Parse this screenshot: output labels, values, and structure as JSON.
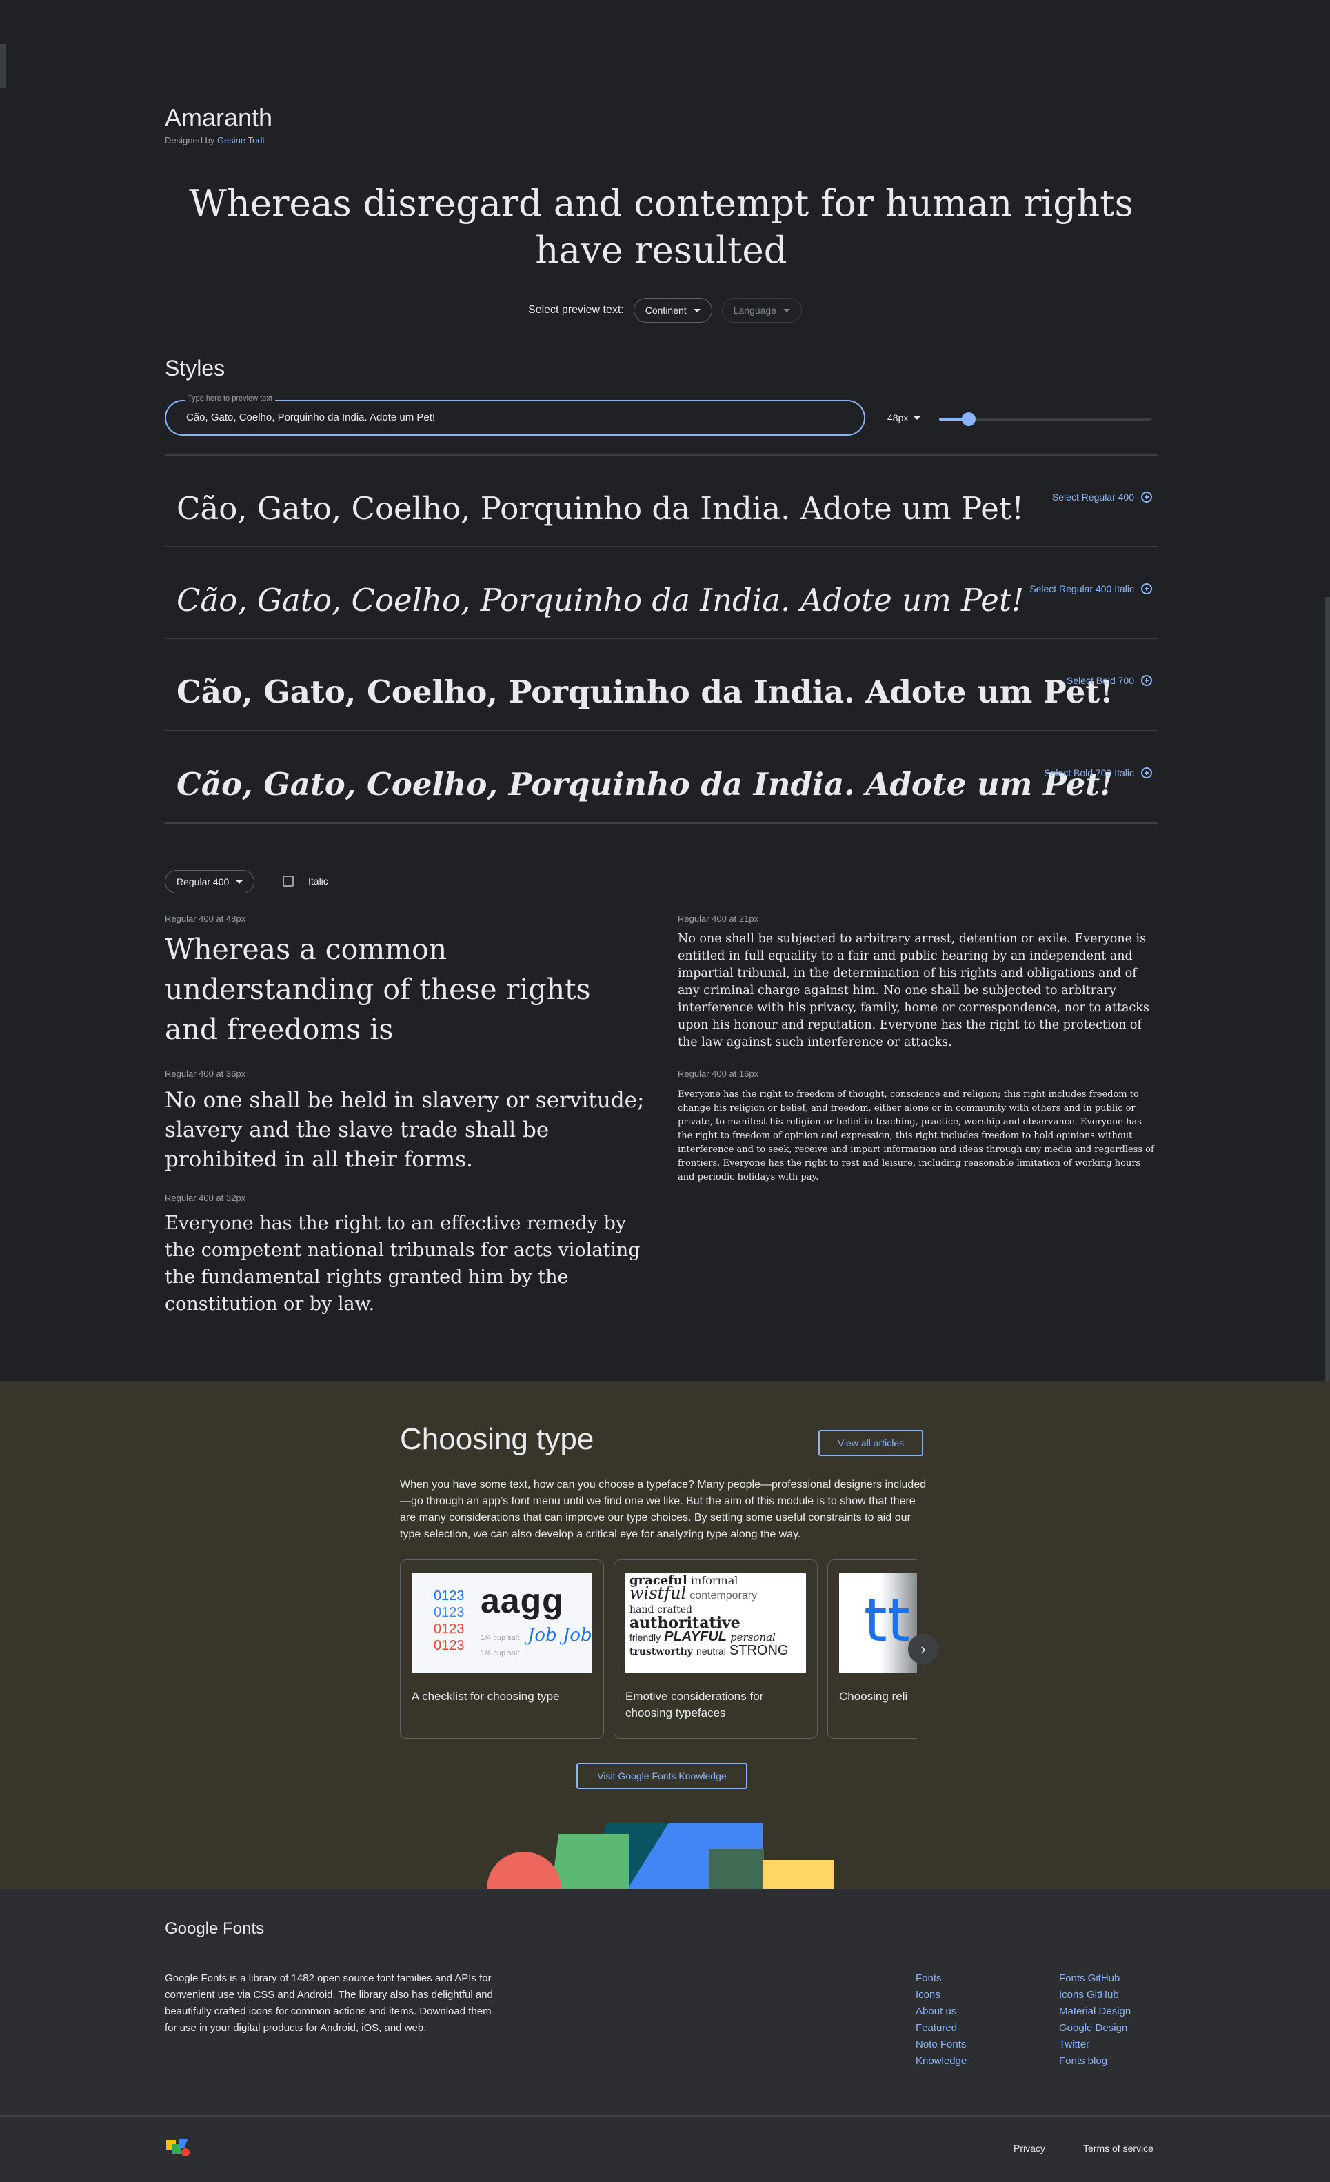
{
  "family": {
    "name": "Amaranth",
    "designed_by": "Designed by",
    "designer": "Gesine Todt"
  },
  "hero_text": "Whereas disregard and contempt for human rights have resulted",
  "preview_controls": {
    "label": "Select preview text:",
    "continent": "Continent",
    "language": "Language"
  },
  "styles": {
    "title": "Styles",
    "input_label": "Type here to preview text",
    "input_value": "Cão, Gato, Coelho, Porquinho da India. Adote um Pet!",
    "size": "48px",
    "size_level_fraction": 0.14,
    "rows": [
      {
        "sample": "Cão, Gato, Coelho, Porquinho da India. Adote um Pet!",
        "select": "Select Regular 400"
      },
      {
        "sample": "Cão, Gato, Coelho, Porquinho da India. Adote um Pet!",
        "select": "Select Regular 400 Italic"
      },
      {
        "sample": "Cão, Gato, Coelho, Porquinho da India. Adote um Pet!",
        "select": "Select Bold 700"
      },
      {
        "sample": "Cão, Gato, Coelho, Porquinho da India. Adote um Pet!",
        "select": "Select Bold 700 Italic"
      }
    ]
  },
  "specimen": {
    "weight": "Regular 400",
    "italic_label": "Italic",
    "blocks": [
      {
        "label": "Regular 400 at 48px",
        "text": "Whereas a common understanding of these rights and freedoms is"
      },
      {
        "label": "Regular 400 at 36px",
        "text": "No one shall be held in slavery or servitude; slavery and the slave trade shall be prohibited in all their forms."
      },
      {
        "label": "Regular 400 at 32px",
        "text": "Everyone has the right to an effective remedy by the competent national tribunals for acts violating the fundamental rights granted him by the constitution or by law."
      },
      {
        "label": "Regular 400 at 21px",
        "text": "No one shall be subjected to arbitrary arrest, detention or exile. Everyone is entitled in full equality to a fair and public hearing by an independent and impartial tribunal, in the determination of his rights and obligations and of any criminal charge against him. No one shall be subjected to arbitrary interference with his privacy, family, home or correspondence, nor to attacks upon his honour and reputation. Everyone has the right to the protection of the law against such interference or attacks."
      },
      {
        "label": "Regular 400 at 16px",
        "text": "Everyone has the right to freedom of thought, conscience and religion; this right includes freedom to change his religion or belief, and freedom, either alone or in community with others and in public or private, to manifest his religion or belief in teaching, practice, worship and observance. Everyone has the right to freedom of opinion and expression; this right includes freedom to hold opinions without interference and to seek, receive and impart information and ideas through any media and regardless of frontiers. Everyone has the right to rest and leisure, including reasonable limitation of working hours and periodic holidays with pay."
      }
    ]
  },
  "choosing_type": {
    "title": "Choosing type",
    "view_all": "View all articles",
    "description": "When you have some text, how can you choose a typeface? Many people—professional designers included—go through an app’s font menu until we find one we like. But the aim of this module is to show that there are many considerations that can improve our type choices. By setting some useful constraints to aid our type selection, we can also develop a critical eye for analyzing type along the way.",
    "cards": [
      {
        "title": "A checklist for choosing type",
        "thumb": {
          "nums": [
            "0123",
            "0123",
            "0123",
            "0123"
          ],
          "big": "aagg",
          "notes": [
            "1/4 cup salt",
            "1/4 cup salt"
          ],
          "script": "Job Job"
        }
      },
      {
        "title": "Emotive considerations for choosing typefaces",
        "thumb": {
          "words": [
            "graceful",
            "informal",
            "wistful",
            "contemporary",
            "hand-crafted",
            "authoritative",
            "friendly",
            "PLAYFUL",
            "personal",
            "trustworthy",
            "neutral",
            "STRONG"
          ]
        }
      },
      {
        "title": "Choosing reli",
        "thumb": {
          "glyph": "tt"
        }
      }
    ],
    "knowledge_button": "Visit Google Fonts Knowledge"
  },
  "footer": {
    "logo": "Google Fonts",
    "description": "Google Fonts is a library of 1482 open source font families and APIs for convenient use via CSS and Android. The library also has delightful and beautifully crafted icons for common actions and items. Download them for use in your digital products for Android, iOS, and web.",
    "links_col1": [
      "Fonts",
      "Icons",
      "About us",
      "Featured",
      "Noto Fonts",
      "Knowledge"
    ],
    "links_col2": [
      "Fonts GitHub",
      "Icons GitHub",
      "Material Design",
      "Google Design",
      "Twitter",
      "Fonts blog"
    ],
    "privacy": "Privacy",
    "terms": "Terms of service"
  },
  "colors": {
    "background": "#202124",
    "accent": "#8ab4f8",
    "choosing_bg": "#38352a",
    "footer_bg": "#2d2e31"
  }
}
